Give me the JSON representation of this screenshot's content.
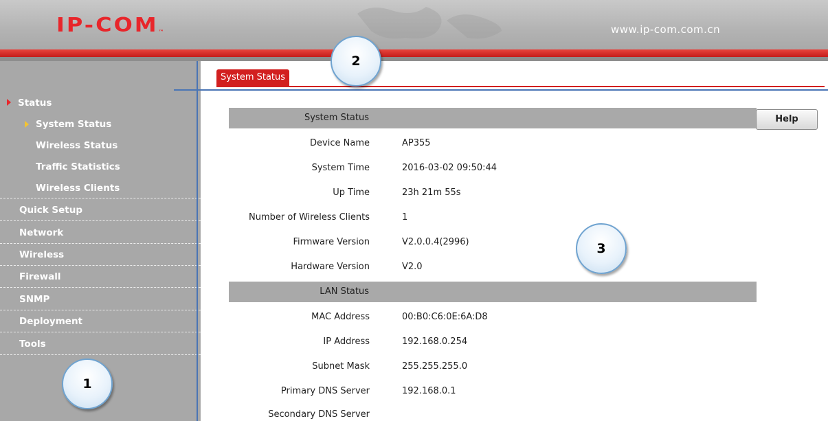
{
  "header": {
    "logo": "IP-COM",
    "site_url": "www.ip-com.com.cn",
    "brand_color": "#e8262b"
  },
  "sidebar": {
    "items": [
      {
        "label": "Status",
        "expanded": true,
        "children": [
          {
            "label": "System Status",
            "selected": true
          },
          {
            "label": "Wireless Status"
          },
          {
            "label": "Traffic Statistics"
          },
          {
            "label": "Wireless Clients"
          }
        ]
      },
      {
        "label": "Quick Setup"
      },
      {
        "label": "Network"
      },
      {
        "label": "Wireless"
      },
      {
        "label": "Firewall"
      },
      {
        "label": "SNMP"
      },
      {
        "label": "Deployment"
      },
      {
        "label": "Tools"
      }
    ]
  },
  "tab": {
    "label": "System Status",
    "color": "#d21f1f"
  },
  "help_button": "Help",
  "system_status": {
    "title": "System Status",
    "rows": [
      {
        "label": "Device Name",
        "value": "AP355"
      },
      {
        "label": "System Time",
        "value": "2016-03-02 09:50:44"
      },
      {
        "label": "Up Time",
        "value": "23h 21m 55s"
      },
      {
        "label": "Number of Wireless Clients",
        "value": "1"
      },
      {
        "label": "Firmware Version",
        "value": "V2.0.0.4(2996)"
      },
      {
        "label": "Hardware Version",
        "value": "V2.0"
      }
    ]
  },
  "lan_status": {
    "title": "LAN Status",
    "rows": [
      {
        "label": "MAC Address",
        "value": "00:B0:C6:0E:6A:D8"
      },
      {
        "label": "IP Address",
        "value": "192.168.0.254"
      },
      {
        "label": "Subnet Mask",
        "value": "255.255.255.0"
      },
      {
        "label": "Primary DNS Server",
        "value": "192.168.0.1"
      },
      {
        "label": "Secondary DNS Server",
        "value": ""
      }
    ]
  },
  "callouts": [
    "1",
    "2",
    "3"
  ]
}
